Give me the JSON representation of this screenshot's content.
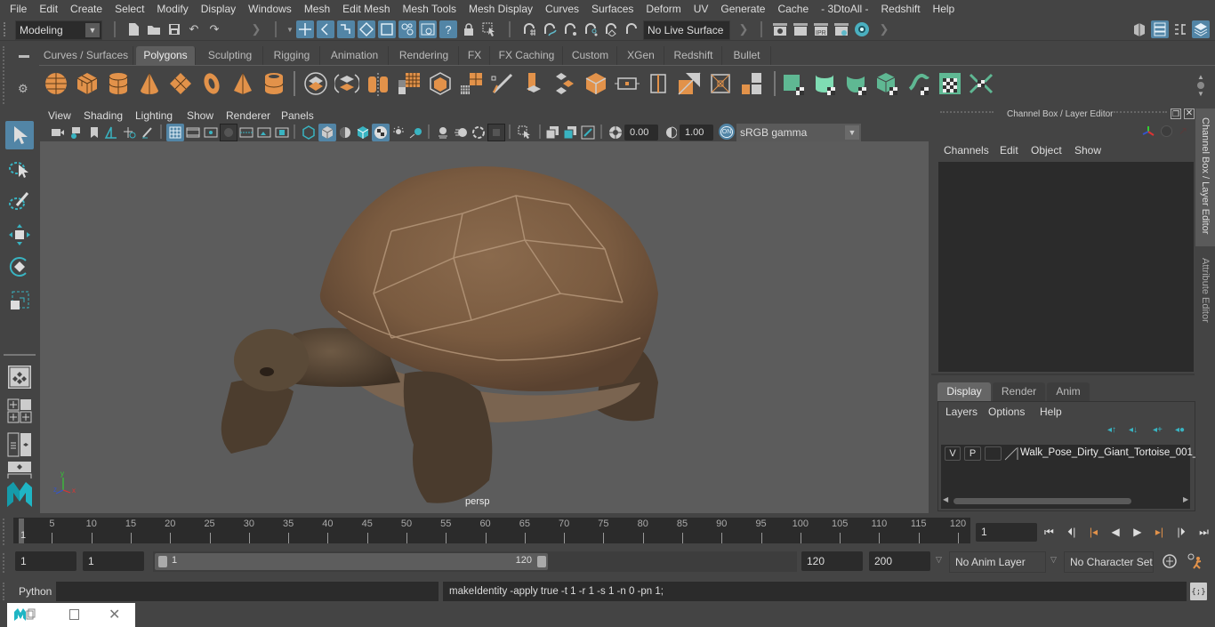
{
  "menubar": {
    "items": [
      "File",
      "Edit",
      "Create",
      "Select",
      "Modify",
      "Display",
      "Windows",
      "Mesh",
      "Edit Mesh",
      "Mesh Tools",
      "Mesh Display",
      "Curves",
      "Surfaces",
      "Deform",
      "UV",
      "Generate",
      "Cache",
      "- 3DtoAll -",
      "Redshift",
      "Help"
    ]
  },
  "statusline": {
    "mode": "Modeling",
    "live_surface": "No Live Surface"
  },
  "shelf": {
    "tabs": [
      "Curves / Surfaces",
      "Polygons",
      "Sculpting",
      "Rigging",
      "Animation",
      "Rendering",
      "FX",
      "FX Caching",
      "Custom",
      "XGen",
      "Redshift",
      "Bullet"
    ],
    "active_tab": "Polygons",
    "accent_orange": "#e2924a",
    "accent_green": "#5fb893"
  },
  "viewport": {
    "menus": [
      "View",
      "Shading",
      "Lighting",
      "Show",
      "Renderer",
      "Panels"
    ],
    "exposure": "0.00",
    "gamma": "1.00",
    "color_mgmt_toggle": "ON",
    "color_space": "sRGB gamma",
    "camera_label": "persp",
    "axis": {
      "x": "x",
      "y": "y",
      "z": "z"
    }
  },
  "channelbox": {
    "title": "Channel Box / Layer Editor",
    "menus": [
      "Channels",
      "Edit",
      "Object",
      "Show"
    ],
    "layer_tabs": [
      "Display",
      "Render",
      "Anim"
    ],
    "active_layer_tab": "Display",
    "layer_menus": [
      "Layers",
      "Options",
      "Help"
    ],
    "layer": {
      "v": "V",
      "p": "P",
      "name": "Walk_Pose_Dirty_Giant_Tortoise_001_"
    }
  },
  "sidetabs": [
    "Channel Box / Layer Editor",
    "Attribute Editor"
  ],
  "timeline": {
    "ticks": [
      5,
      10,
      15,
      20,
      25,
      30,
      35,
      40,
      45,
      50,
      55,
      60,
      65,
      70,
      75,
      80,
      85,
      90,
      95,
      100,
      105,
      110,
      115,
      120
    ],
    "current_frame_marker": "1",
    "current_frame": "1",
    "start": 1,
    "end": 120
  },
  "range": {
    "start_time": "1",
    "playback_start": "1",
    "slider_start": "1",
    "slider_end": "120",
    "playback_end": "120",
    "end_time": "200",
    "anim_layer": "No Anim Layer",
    "character_set": "No Character Set"
  },
  "cmdline": {
    "language": "Python",
    "input": "",
    "result": "makeIdentity -apply true -t 1 -r 1 -s 1 -n 0 -pn 1;"
  }
}
